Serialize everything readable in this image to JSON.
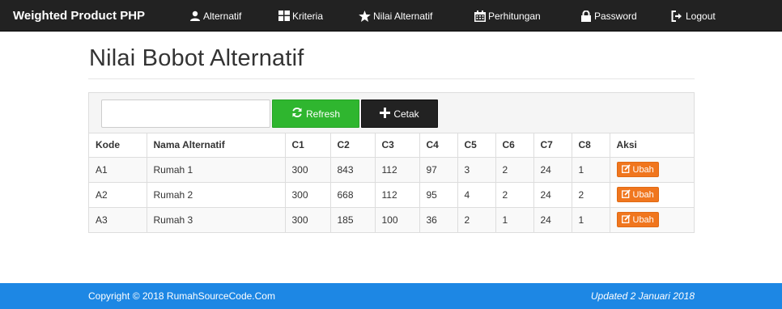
{
  "navbar": {
    "brand": "Weighted Product PHP",
    "items": [
      {
        "label": "Alternatif",
        "icon": "user-icon"
      },
      {
        "label": "Kriteria",
        "icon": "grid-icon"
      },
      {
        "label": "Nilai Alternatif",
        "icon": "star-icon"
      },
      {
        "label": "Perhitungan",
        "icon": "calendar-icon"
      },
      {
        "label": "Password",
        "icon": "lock-icon"
      },
      {
        "label": "Logout",
        "icon": "logout-icon"
      }
    ]
  },
  "page": {
    "title": "Nilai Bobot Alternatif"
  },
  "toolbar": {
    "search_value": "",
    "refresh_label": "Refresh",
    "cetak_label": "Cetak"
  },
  "table": {
    "headers": [
      "Kode",
      "Nama Alternatif",
      "C1",
      "C2",
      "C3",
      "C4",
      "C5",
      "C6",
      "C7",
      "C8",
      "Aksi"
    ],
    "rows": [
      {
        "kode": "A1",
        "nama": "Rumah 1",
        "c1": "300",
        "c2": "843",
        "c3": "112",
        "c4": "97",
        "c5": "3",
        "c6": "2",
        "c7": "24",
        "c8": "1",
        "aksi": "Ubah"
      },
      {
        "kode": "A2",
        "nama": "Rumah 2",
        "c1": "300",
        "c2": "668",
        "c3": "112",
        "c4": "95",
        "c5": "4",
        "c6": "2",
        "c7": "24",
        "c8": "2",
        "aksi": "Ubah"
      },
      {
        "kode": "A3",
        "nama": "Rumah 3",
        "c1": "300",
        "c2": "185",
        "c3": "100",
        "c4": "36",
        "c5": "2",
        "c6": "1",
        "c7": "24",
        "c8": "1",
        "aksi": "Ubah"
      }
    ]
  },
  "footer": {
    "copyright": "Copyright © 2018 RumahSourceCode.Com",
    "updated": "Updated 2 Januari 2018"
  },
  "colors": {
    "navbar": "#222222",
    "refresh_button": "#2fb62f",
    "cetak_button": "#222222",
    "ubah_button": "#f0761e",
    "footer": "#1d87e4"
  }
}
